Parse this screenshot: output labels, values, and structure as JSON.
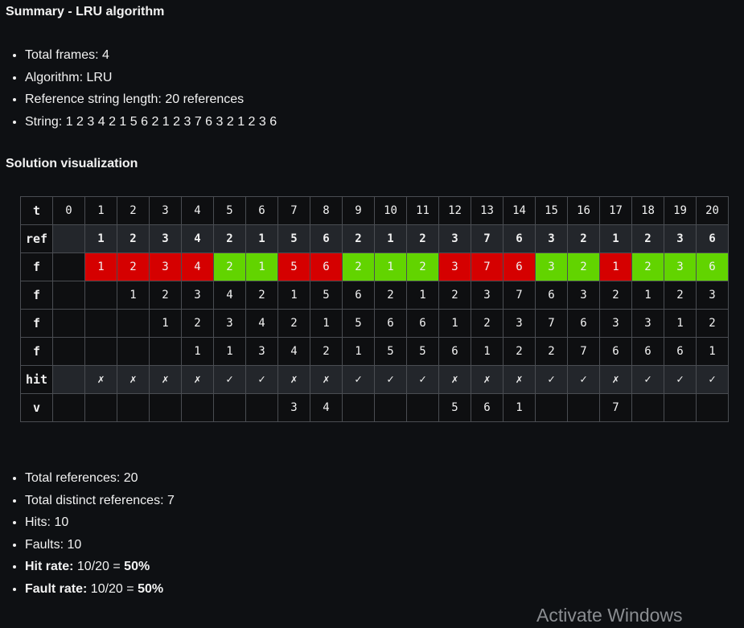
{
  "summary": {
    "title": "Summary - LRU algorithm",
    "items": [
      "Total frames: 4",
      "Algorithm: LRU",
      "Reference string length:  20 references",
      "String:  1 2 3 4 2 1 5 6 2 1 2 3 7 6 3 2 1 2 3 6"
    ]
  },
  "visualization": {
    "title": "Solution visualization",
    "row_labels": {
      "t": "t",
      "ref": "ref",
      "frame": "f",
      "hit": "hit",
      "victim": "v"
    },
    "t": [
      "0",
      "1",
      "2",
      "3",
      "4",
      "5",
      "6",
      "7",
      "8",
      "9",
      "10",
      "11",
      "12",
      "13",
      "14",
      "15",
      "16",
      "17",
      "18",
      "19",
      "20"
    ],
    "ref": [
      "",
      "1",
      "2",
      "3",
      "4",
      "2",
      "1",
      "5",
      "6",
      "2",
      "1",
      "2",
      "3",
      "7",
      "6",
      "3",
      "2",
      "1",
      "2",
      "3",
      "6"
    ],
    "frames": [
      [
        "",
        "1",
        "2",
        "3",
        "4",
        "2",
        "1",
        "5",
        "6",
        "2",
        "1",
        "2",
        "3",
        "7",
        "6",
        "3",
        "2",
        "1",
        "2",
        "3",
        "6"
      ],
      [
        "",
        "",
        "1",
        "2",
        "3",
        "4",
        "2",
        "1",
        "5",
        "6",
        "2",
        "1",
        "2",
        "3",
        "7",
        "6",
        "3",
        "2",
        "1",
        "2",
        "3"
      ],
      [
        "",
        "",
        "",
        "1",
        "2",
        "3",
        "4",
        "2",
        "1",
        "5",
        "6",
        "6",
        "1",
        "2",
        "3",
        "7",
        "6",
        "3",
        "3",
        "1",
        "2"
      ],
      [
        "",
        "",
        "",
        "",
        "1",
        "1",
        "3",
        "4",
        "2",
        "1",
        "5",
        "5",
        "6",
        "1",
        "2",
        "2",
        "7",
        "6",
        "6",
        "6",
        "1"
      ]
    ],
    "hit": [
      "",
      "✗",
      "✗",
      "✗",
      "✗",
      "✓",
      "✓",
      "✗",
      "✗",
      "✓",
      "✓",
      "✓",
      "✗",
      "✗",
      "✗",
      "✓",
      "✓",
      "✗",
      "✓",
      "✓",
      "✓"
    ],
    "victim": [
      "",
      "",
      "",
      "",
      "",
      "",
      "",
      "3",
      "4",
      "",
      "",
      "",
      "5",
      "6",
      "1",
      "",
      "",
      "7",
      "",
      "",
      ""
    ],
    "colors": {
      "fault": "#d50000",
      "hit": "#62d400"
    }
  },
  "results": {
    "items": [
      {
        "label": "",
        "text": "Total references: 20"
      },
      {
        "label": "",
        "text": "Total distinct references: 7"
      },
      {
        "label": "",
        "text": "Hits: 10"
      },
      {
        "label": "",
        "text": "Faults: 10"
      },
      {
        "label": "Hit rate:",
        "text": " 10/20 = ",
        "strong": "50%"
      },
      {
        "label": "Fault rate:",
        "text": " 10/20 = ",
        "strong": "50%"
      }
    ]
  },
  "watermark": "Activate Windows"
}
